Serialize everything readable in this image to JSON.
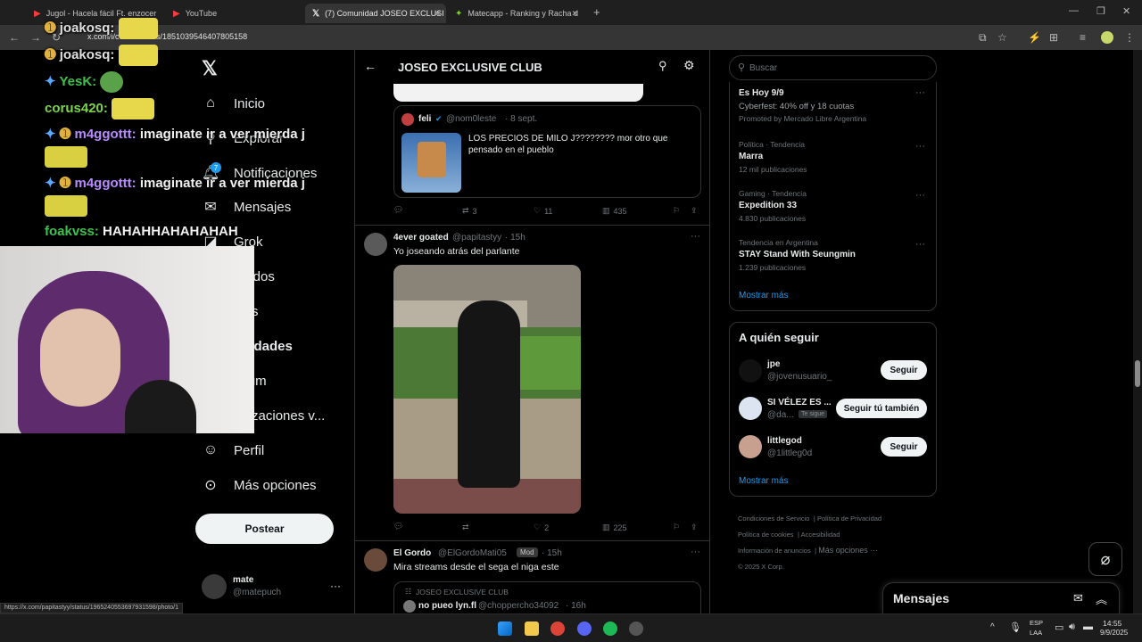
{
  "browser": {
    "tabs": [
      {
        "title": "Jugol - Hacela fácil Ft. enzocer",
        "active": false
      },
      {
        "title": "YouTube",
        "active": false
      },
      {
        "title": "(7) Comunidad JOSEO EXCLUSI",
        "active": true
      },
      {
        "title": "Matecapp - Ranking y Racha d",
        "active": false
      }
    ],
    "url": "x.com/i/communities/1851039546407805158",
    "status_url": "https://x.com/papitastyy/status/1965240553697931598/photo/1"
  },
  "nav": {
    "items": [
      {
        "label": "Inicio",
        "icon": "home-icon"
      },
      {
        "label": "Explorar",
        "icon": "search-icon"
      },
      {
        "label": "Notificaciones",
        "icon": "bell-icon",
        "badge": "7"
      },
      {
        "label": "Mensajes",
        "icon": "mail-icon"
      },
      {
        "label": "Grok",
        "icon": "grok-icon"
      },
      {
        "label": "rdados",
        "icon": "bookmark-icon"
      },
      {
        "label": "ajos",
        "icon": "briefcase-icon"
      },
      {
        "label": "unidades",
        "icon": "communities-icon"
      },
      {
        "label": "mium",
        "icon": "premium-icon"
      },
      {
        "label": "anizaciones v...",
        "icon": "lightning-icon"
      },
      {
        "label": "Perfil",
        "icon": "user-icon"
      },
      {
        "label": "Más opciones",
        "icon": "more-circle-icon"
      }
    ],
    "post_label": "Postear",
    "account": {
      "name": "mate",
      "handle": "@matepuch"
    }
  },
  "header": {
    "title": "JOSEO EXCLUSIVE CLUB"
  },
  "feed": {
    "quoted": {
      "author": "feli",
      "handle": "@nom0leste",
      "date": "· 8 sept.",
      "text": "LOS PRECIOS DE MILO J???????? mor otro que pensado en el pueblo"
    },
    "tweet0_actions": {
      "retweets": "3",
      "likes": "11",
      "views": "435"
    },
    "tweet1": {
      "author": "4ever goated",
      "handle": "@papitastyy",
      "time": "· 15h",
      "text": "Yo joseando atrás del parlante",
      "retweets": "",
      "likes": "2",
      "views": "225"
    },
    "tweet2": {
      "author": "El Gordo",
      "handle": "@ElGordoMati05",
      "badge": "Mod",
      "time": "· 15h",
      "text": "Mira streams desde el sega el niga este",
      "quote_community": "JOSEO EXCLUSIVE CLUB",
      "quote_author": "no pueo lyn.fl",
      "quote_handle": "@choppercho34092",
      "quote_time": "· 16h"
    }
  },
  "right": {
    "search_placeholder": "Buscar",
    "trends": [
      {
        "meta": "",
        "title": "Es Hoy 9/9",
        "sub": "Cyberfest: 40% off y 18 cuotas",
        "promo": "Promoted by Mercado Libre Argentina"
      },
      {
        "meta": "Política · Tendencia",
        "title": "Marra",
        "sub": "12 mil publicaciones"
      },
      {
        "meta": "Gaming · Tendencia",
        "title": "Expedition 33",
        "sub": "4.830 publicaciones"
      },
      {
        "meta": "Tendencia en Argentina",
        "title": "STAY Stand With Seungmin",
        "sub": "1.239 publicaciones"
      }
    ],
    "show_more": "Mostrar más",
    "who_to_follow": "A quién seguir",
    "follows": [
      {
        "name": "jpe",
        "handle": "@jovenusuario_",
        "button": "Seguir"
      },
      {
        "name": "SI VÉLEZ ES ...",
        "handle": "@da...",
        "tag": "Te sigue",
        "button": "Seguir tú también"
      },
      {
        "name": "littlegod",
        "handle": "@1littleg0d",
        "button": "Seguir"
      }
    ],
    "show_more2": "Mostrar más",
    "footer": [
      "Condiciones de Servicio",
      "Política de Privacidad",
      "Política de cookies",
      "Accesibilidad",
      "Información de anuncios",
      "Más opciones ···",
      "© 2025 X Corp."
    ],
    "messages_label": "Mensajes"
  },
  "chat": [
    {
      "user": "joakosq:",
      "color": "#e0e0e0"
    },
    {
      "user": "joakosq:",
      "color": "#e0e0e0"
    },
    {
      "user": "YesK:",
      "color": "#3ec24c"
    },
    {
      "user": "corus420:",
      "color": "#7cd44a"
    },
    {
      "user": "m4ggottt:",
      "color": "#b88cff",
      "text": "imaginate ir a ver mierda j"
    },
    {
      "user": "m4ggottt:",
      "color": "#b88cff",
      "text": "imaginate ir a ver mierda j"
    },
    {
      "user": "foakvss:",
      "color": "#3ec24c",
      "text": "HAHAHHAHAHAHAH"
    }
  ],
  "taskbar": {
    "lang": "ESP",
    "lang2": "LAA",
    "time": "14:55",
    "date": "9/9/2025"
  }
}
